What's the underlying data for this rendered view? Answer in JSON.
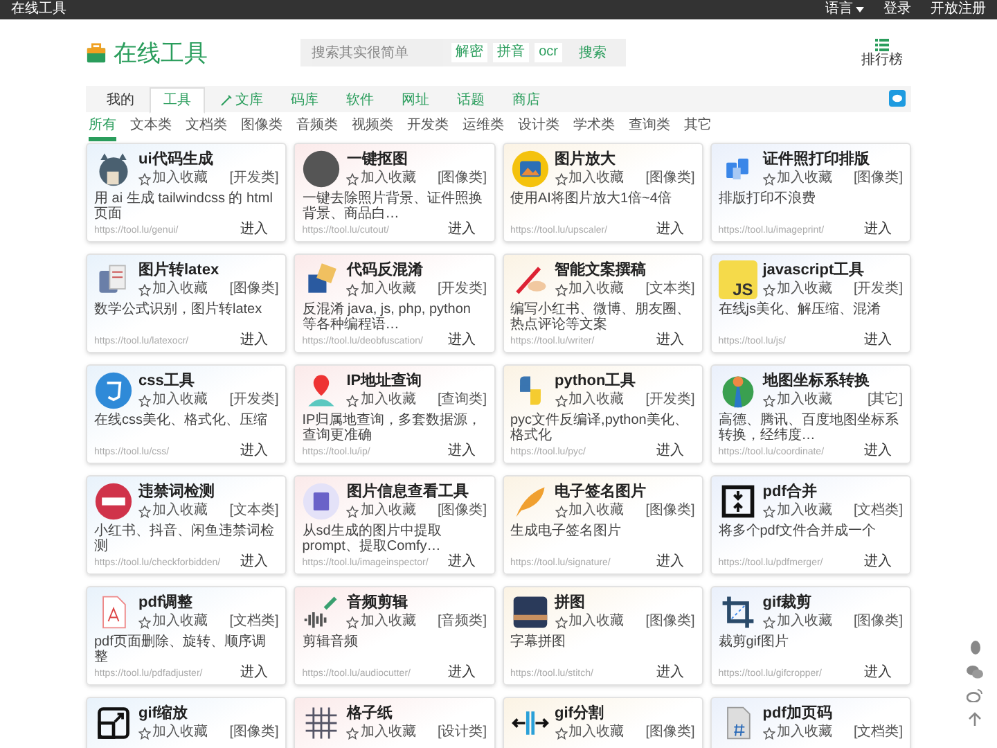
{
  "top_bar": {
    "title": "在线工具",
    "links": [
      {
        "label": "语言",
        "dropdown": true
      },
      {
        "label": "登录",
        "dropdown": false
      },
      {
        "label": "开放注册",
        "dropdown": false
      }
    ]
  },
  "header": {
    "logo": "在线工具",
    "search": {
      "placeholder": "搜索其实很简单",
      "quick_links": [
        "解密",
        "拼音",
        "ocr"
      ],
      "button": "搜索"
    },
    "ranking": "排行榜"
  },
  "nav": {
    "tabs": [
      {
        "label": "我的",
        "kind": "user",
        "selected": false
      },
      {
        "label": "工具",
        "kind": "section",
        "selected": true
      },
      {
        "label": "文库",
        "kind": "featured",
        "selected": false
      },
      {
        "label": "码库",
        "kind": "section",
        "selected": false
      },
      {
        "label": "软件",
        "kind": "section",
        "selected": false
      },
      {
        "label": "网址",
        "kind": "section",
        "selected": false
      },
      {
        "label": "话题",
        "kind": "section",
        "selected": false
      },
      {
        "label": "商店",
        "kind": "section",
        "selected": false
      }
    ]
  },
  "filters": [
    {
      "label": "所有",
      "selected": true
    },
    {
      "label": "文本类",
      "selected": false
    },
    {
      "label": "文档类",
      "selected": false
    },
    {
      "label": "图像类",
      "selected": false
    },
    {
      "label": "音频类",
      "selected": false
    },
    {
      "label": "视频类",
      "selected": false
    },
    {
      "label": "开发类",
      "selected": false
    },
    {
      "label": "运维类",
      "selected": false
    },
    {
      "label": "设计类",
      "selected": false
    },
    {
      "label": "学术类",
      "selected": false
    },
    {
      "label": "查询类",
      "selected": false
    },
    {
      "label": "其它",
      "selected": false
    }
  ],
  "cards": [
    {
      "title": "ui代码生成",
      "favorite": "加入收藏",
      "category": "[开发类]",
      "description": "用 ai 生成 tailwindcss 的 html 页面",
      "url": "https://tool.lu/genui/",
      "enter": "进入"
    },
    {
      "title": "一键抠图",
      "favorite": "加入收藏",
      "category": "[图像类]",
      "description": "一键去除照片背景、证件照换背景、商品白…",
      "url": "https://tool.lu/cutout/",
      "enter": "进入"
    },
    {
      "title": "图片放大",
      "favorite": "加入收藏",
      "category": "[图像类]",
      "description": "使用AI将图片放大1倍~4倍",
      "url": "https://tool.lu/upscaler/",
      "enter": "进入"
    },
    {
      "title": "证件照打印排版",
      "favorite": "加入收藏",
      "category": "[图像类]",
      "description": "排版打印不浪费",
      "url": "https://tool.lu/imageprint/",
      "enter": "进入"
    },
    {
      "title": "图片转latex",
      "favorite": "加入收藏",
      "category": "[图像类]",
      "description": "数学公式识别，图片转latex",
      "url": "https://tool.lu/latexocr/",
      "enter": "进入"
    },
    {
      "title": "代码反混淆",
      "favorite": "加入收藏",
      "category": "[开发类]",
      "description": "反混淆 java, js, php, python 等各种编程语…",
      "url": "https://tool.lu/deobfuscation/",
      "enter": "进入"
    },
    {
      "title": "智能文案撰稿",
      "favorite": "加入收藏",
      "category": "[文本类]",
      "description": "编写小红书、微博、朋友圈、热点评论等文案",
      "url": "https://tool.lu/writer/",
      "enter": "进入"
    },
    {
      "title": "javascript工具",
      "favorite": "加入收藏",
      "category": "[开发类]",
      "description": "在线js美化、解压缩、混淆",
      "url": "https://tool.lu/js/",
      "enter": "进入",
      "badge": "JS"
    },
    {
      "title": "css工具",
      "favorite": "加入收藏",
      "category": "[开发类]",
      "description": "在线css美化、格式化、压缩",
      "url": "https://tool.lu/css/",
      "enter": "进入"
    },
    {
      "title": "IP地址查询",
      "favorite": "加入收藏",
      "category": "[查询类]",
      "description": "IP归属地查询，多套数据源，查询更准确",
      "url": "https://tool.lu/ip/",
      "enter": "进入"
    },
    {
      "title": "python工具",
      "favorite": "加入收藏",
      "category": "[开发类]",
      "description": "pyc文件反编译,python美化、格式化",
      "url": "https://tool.lu/pyc/",
      "enter": "进入"
    },
    {
      "title": "地图坐标系转换",
      "favorite": "加入收藏",
      "category": "[其它]",
      "description": "高德、腾讯、百度地图坐标系转换，经纬度…",
      "url": "https://tool.lu/coordinate/",
      "enter": "进入"
    },
    {
      "title": "违禁词检测",
      "favorite": "加入收藏",
      "category": "[文本类]",
      "description": "小红书、抖音、闲鱼违禁词检测",
      "url": "https://tool.lu/checkforbidden/",
      "enter": "进入"
    },
    {
      "title": "图片信息查看工具",
      "favorite": "加入收藏",
      "category": "[图像类]",
      "description": "从sd生成的图片中提取prompt、提取Comfy…",
      "url": "https://tool.lu/imageinspector/",
      "enter": "进入"
    },
    {
      "title": "电子签名图片",
      "favorite": "加入收藏",
      "category": "[图像类]",
      "description": "生成电子签名图片",
      "url": "https://tool.lu/signature/",
      "enter": "进入"
    },
    {
      "title": "pdf合并",
      "favorite": "加入收藏",
      "category": "[文档类]",
      "description": "将多个pdf文件合并成一个",
      "url": "https://tool.lu/pdfmerger/",
      "enter": "进入"
    },
    {
      "title": "pdf调整",
      "favorite": "加入收藏",
      "category": "[文档类]",
      "description": "pdf页面删除、旋转、顺序调整",
      "url": "https://tool.lu/pdfadjuster/",
      "enter": "进入"
    },
    {
      "title": "音频剪辑",
      "favorite": "加入收藏",
      "category": "[音频类]",
      "description": "剪辑音频",
      "url": "https://tool.lu/audiocutter/",
      "enter": "进入"
    },
    {
      "title": "拼图",
      "favorite": "加入收藏",
      "category": "[图像类]",
      "description": "字幕拼图",
      "url": "https://tool.lu/stitch/",
      "enter": "进入"
    },
    {
      "title": "gif裁剪",
      "favorite": "加入收藏",
      "category": "[图像类]",
      "description": "裁剪gif图片",
      "url": "https://tool.lu/gifcropper/",
      "enter": "进入"
    },
    {
      "title": "gif缩放",
      "favorite": "加入收藏",
      "category": "[图像类]"
    },
    {
      "title": "格子纸",
      "favorite": "加入收藏",
      "category": "[设计类]"
    },
    {
      "title": "gif分割",
      "favorite": "加入收藏",
      "category": "[图像类]"
    },
    {
      "title": "pdf加页码",
      "favorite": "加入收藏",
      "category": "[文档类]"
    }
  ]
}
